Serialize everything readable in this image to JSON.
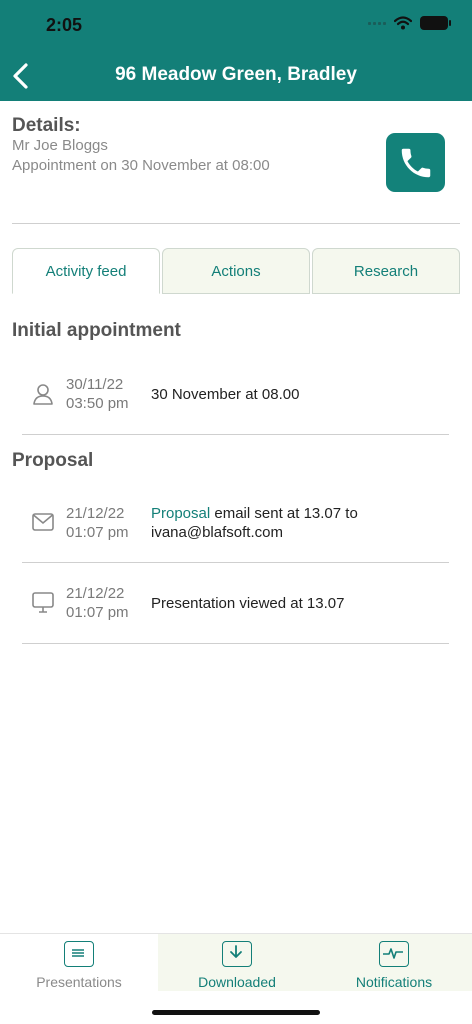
{
  "status_bar": {
    "time": "2:05"
  },
  "header": {
    "title": "96 Meadow Green, Bradley"
  },
  "details": {
    "label": "Details:",
    "customer": "Mr Joe Bloggs",
    "appointment": "Appointment on 30 November at 08:00"
  },
  "tabs": [
    {
      "label": "Activity feed",
      "active": true
    },
    {
      "label": "Actions",
      "active": false
    },
    {
      "label": "Research",
      "active": false
    }
  ],
  "sections": {
    "initial": {
      "title": "Initial appointment",
      "rows": [
        {
          "icon": "person-icon",
          "date": "30/11/22",
          "time": "03:50 pm",
          "text": "30 November at 08.00"
        }
      ]
    },
    "proposal": {
      "title": "Proposal",
      "rows": [
        {
          "icon": "envelope-icon",
          "date": "21/12/22",
          "time": "01:07 pm",
          "link": "Proposal",
          "text": " email sent at 13.07 to ivana@blafsoft.com"
        },
        {
          "icon": "monitor-icon",
          "date": "21/12/22",
          "time": "01:07 pm",
          "text": "Presentation viewed at 13.07"
        }
      ]
    }
  },
  "bottom_nav": [
    {
      "label": "Presentations",
      "icon": "presentations-icon",
      "selected": false
    },
    {
      "label": "Downloaded",
      "icon": "download-icon",
      "selected": true
    },
    {
      "label": "Notifications",
      "icon": "pulse-icon",
      "selected": true
    }
  ],
  "colors": {
    "brand": "#137f78",
    "tab_bg": "#f5f8ee"
  }
}
